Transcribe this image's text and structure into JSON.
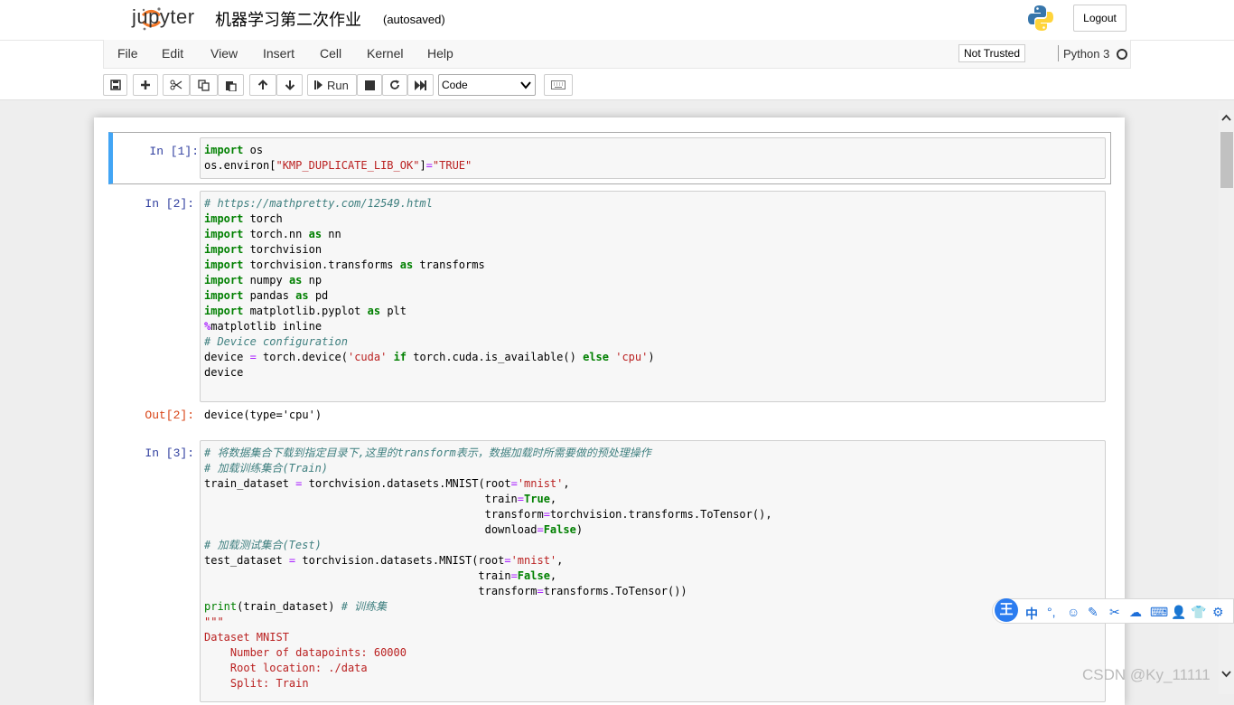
{
  "header": {
    "logo_text": "jupyter",
    "notebook_title": "机器学习第二次作业",
    "autosave_status": "(autosaved)",
    "logout_label": "Logout"
  },
  "menu": {
    "items": [
      "File",
      "Edit",
      "View",
      "Insert",
      "Cell",
      "Kernel",
      "Help"
    ],
    "trust_label": "Not Trusted",
    "kernel_name": "Python 3"
  },
  "toolbar": {
    "run_label": "Run",
    "cell_type": "Code",
    "icons": [
      "save-icon",
      "add-cell-icon",
      "cut-icon",
      "copy-icon",
      "paste-icon",
      "move-up-icon",
      "move-down-icon",
      "run-icon",
      "stop-icon",
      "restart-icon",
      "fast-forward-icon",
      "chevron-down-icon",
      "keyboard-icon"
    ]
  },
  "cells": [
    {
      "prompt": "In [1]:",
      "lines": [
        "import os",
        "os.environ[\"KMP_DUPLICATE_LIB_OK\"]=\"TRUE\""
      ]
    },
    {
      "prompt": "In [2]:",
      "lines": [
        "# https://mathpretty.com/12549.html",
        "import torch",
        "import torch.nn as nn",
        "import torchvision",
        "import torchvision.transforms as transforms",
        "import numpy as np",
        "import pandas as pd",
        "import matplotlib.pyplot as plt",
        "%matplotlib inline",
        "# Device configuration",
        "device = torch.device('cuda' if torch.cuda.is_available() else 'cpu')",
        "device"
      ],
      "output_prompt": "Out[2]:",
      "output": "device(type='cpu')"
    },
    {
      "prompt": "In [3]:",
      "lines": [
        "# 将数据集合下载到指定目录下,这里的transform表示，数据加载时所需要做的预处理操作",
        "# 加载训练集合(Train)",
        "train_dataset = torchvision.datasets.MNIST(root='mnist',",
        "                                           train=True,",
        "                                           transform=torchvision.transforms.ToTensor(),",
        "                                           download=False)",
        "# 加载测试集合(Test)",
        "test_dataset = torchvision.datasets.MNIST(root='mnist',",
        "                                          train=False,",
        "                                          transform=transforms.ToTensor())",
        "print(train_dataset) # 训练集",
        "\"\"\"",
        "Dataset MNIST",
        "    Number of datapoints: 60000",
        "    Root location: ./data",
        "    Split: Train"
      ]
    }
  ],
  "ime_toolbar": {
    "logo": "王",
    "items": [
      "中",
      "°,",
      "☺",
      "✎",
      "✂",
      "☁",
      "⌨",
      "👤",
      "👕",
      "⚙"
    ]
  },
  "watermark": "CSDN @Ky_11111"
}
